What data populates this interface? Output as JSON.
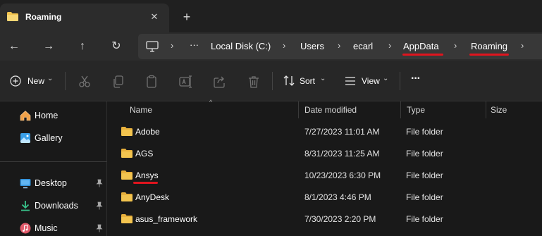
{
  "window": {
    "tab_title": "Roaming",
    "close_glyph": "✕",
    "new_tab_glyph": "+"
  },
  "nav": {
    "back_glyph": "←",
    "forward_glyph": "→",
    "up_glyph": "↑",
    "refresh_glyph": "↻"
  },
  "address": {
    "overflow": "···",
    "separator": "›",
    "crumbs": [
      "Local Disk (C:)",
      "Users",
      "ecarl",
      "AppData",
      "Roaming"
    ]
  },
  "toolbar": {
    "new_label": "New",
    "sort_label": "Sort",
    "view_label": "View",
    "more_glyph": "···",
    "chevron": "⌄"
  },
  "sidebar": {
    "items": [
      {
        "label": "Home",
        "icon": "home-icon"
      },
      {
        "label": "Gallery",
        "icon": "gallery-icon"
      },
      {
        "label": "Desktop",
        "icon": "desktop-icon",
        "pinned": true
      },
      {
        "label": "Downloads",
        "icon": "downloads-icon",
        "pinned": true
      },
      {
        "label": "Music",
        "icon": "music-icon",
        "pinned": true
      }
    ]
  },
  "files": {
    "columns": [
      "Name",
      "Date modified",
      "Type",
      "Size"
    ],
    "sort_glyph": "^",
    "rows": [
      {
        "name": "Adobe",
        "date": "7/27/2023 11:01 AM",
        "type": "File folder"
      },
      {
        "name": "AGS",
        "date": "8/31/2023 11:25 AM",
        "type": "File folder"
      },
      {
        "name": "Ansys",
        "date": "10/23/2023 6:30 PM",
        "type": "File folder"
      },
      {
        "name": "AnyDesk",
        "date": "8/1/2023 4:46 PM",
        "type": "File folder"
      },
      {
        "name": "asus_framework",
        "date": "7/30/2023 2:20 PM",
        "type": "File folder"
      }
    ]
  },
  "colors": {
    "folder": "#f3c44f",
    "highlight_mark": "#e0141e",
    "accent": "#4cc2ff"
  }
}
